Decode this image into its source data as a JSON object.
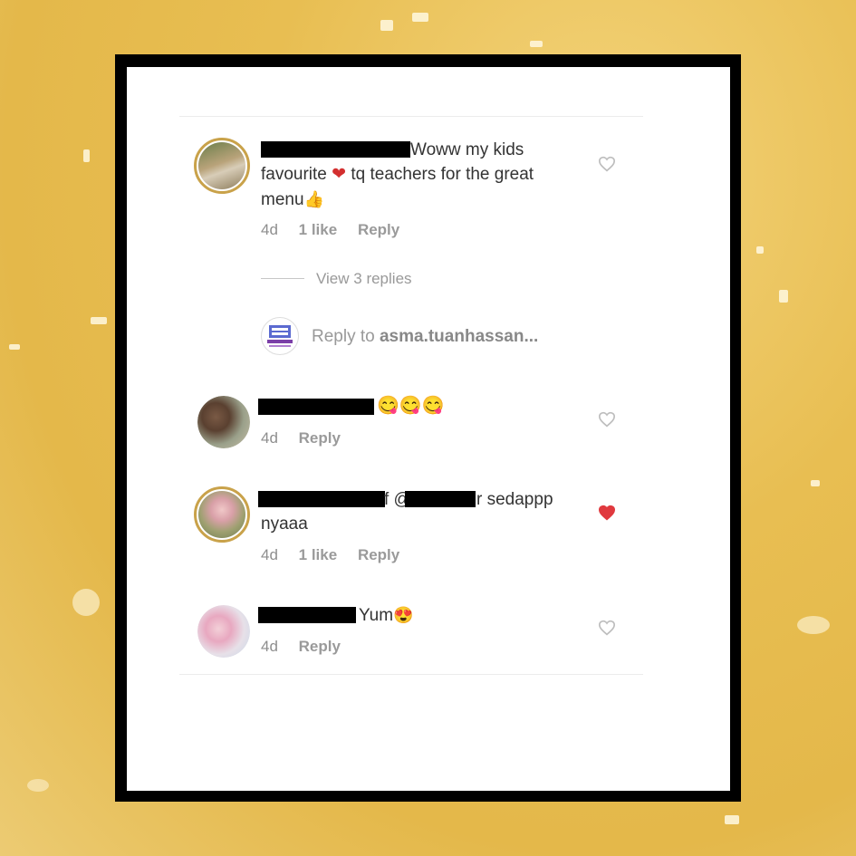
{
  "comments": [
    {
      "text_line1": "Woww my kids",
      "text_line2a": "favourite",
      "text_line2b": "tq teachers for the great",
      "text_line3": "menu",
      "emoji_heart": "❤",
      "emoji_thumb": "👍",
      "time": "4d",
      "likes": "1 like",
      "reply": "Reply",
      "liked": false
    },
    {
      "text": "😋😋😋",
      "time": "4d",
      "reply": "Reply",
      "liked": false
    },
    {
      "text_line1": "sedappp",
      "text_line1_mid": "f @",
      "text_line1_r": "r",
      "text_line2": "nyaaa",
      "time": "4d",
      "likes": "1 like",
      "reply": "Reply",
      "liked": true
    },
    {
      "text": "Yum",
      "emoji": "😍",
      "time": "4d",
      "reply": "Reply",
      "liked": false
    }
  ],
  "view_replies": "View 3 replies",
  "reply_input": {
    "prefix": "Reply to ",
    "username": "asma.tuanhassan..."
  },
  "colors": {
    "liked_heart": "#e0393e",
    "unliked_heart": "#bdbdbd",
    "background": "#e8be52"
  }
}
